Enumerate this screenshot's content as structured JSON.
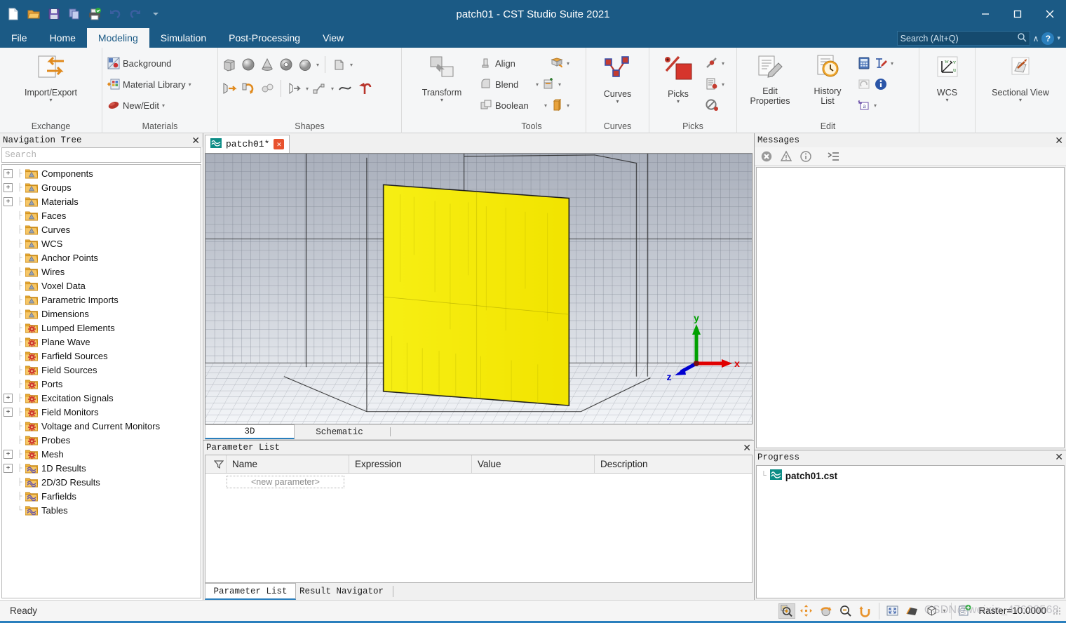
{
  "window": {
    "title": "patch01 - CST Studio Suite 2021",
    "minimize": "─",
    "maximize": "□",
    "close": "✕"
  },
  "quick_access": {
    "items": [
      {
        "name": "new-icon",
        "tip": "New"
      },
      {
        "name": "open-icon",
        "tip": "Open"
      },
      {
        "name": "save-icon",
        "tip": "Save"
      },
      {
        "name": "copy-icon",
        "tip": "Copy"
      },
      {
        "name": "print-icon",
        "tip": "Print"
      },
      {
        "name": "undo-icon",
        "tip": "Undo"
      },
      {
        "name": "redo-icon",
        "tip": "Redo"
      },
      {
        "name": "customize-icon",
        "tip": "Customize Quick Access Toolbar"
      }
    ]
  },
  "ribbon": {
    "tabs": [
      {
        "label": "File",
        "active": false
      },
      {
        "label": "Home",
        "active": false
      },
      {
        "label": "Modeling",
        "active": true
      },
      {
        "label": "Simulation",
        "active": false
      },
      {
        "label": "Post-Processing",
        "active": false
      },
      {
        "label": "View",
        "active": false
      }
    ],
    "search": {
      "placeholder": "Search (Alt+Q)",
      "value": ""
    },
    "help_label": "?",
    "collapse_label": "∧",
    "groups": [
      {
        "label": "Exchange",
        "big": {
          "label_line1": "Import/Export",
          "label_line2": "",
          "has_dropdown": true
        }
      },
      {
        "label": "Materials",
        "items": [
          {
            "label": "Background",
            "icon": "background-icon",
            "dropdown": false
          },
          {
            "label": "Material Library",
            "icon": "material-library-icon",
            "dropdown": true
          },
          {
            "label": "New/Edit",
            "icon": "new-edit-material-icon",
            "dropdown": true
          }
        ]
      },
      {
        "label": "Shapes",
        "row1": [
          "brick-icon",
          "sphere-icon",
          "cone-icon",
          "torus-icon",
          "ellipsoid-icon",
          "extrude-shape-icon"
        ],
        "row2": [
          "extrude-icon",
          "rotate-icon",
          "loft-icon",
          "extrude-curve-icon",
          "sweep-curve-icon",
          "trace-icon",
          "bend-icon"
        ]
      },
      {
        "label": "Tools",
        "items": [
          {
            "label": "Align",
            "icon": "align-icon",
            "dropdown": false
          },
          {
            "label": "Blend",
            "icon": "blend-icon",
            "dropdown": true
          },
          {
            "label": "Boolean",
            "icon": "boolean-icon",
            "dropdown": true
          }
        ],
        "side_icons": [
          "shape-tool-icon",
          "local-modification-icon",
          "material-tool-icon"
        ]
      },
      {
        "label": "Curves",
        "big": {
          "label_line1": "Curves",
          "label_line2": "",
          "has_dropdown": true
        }
      },
      {
        "label": "Picks",
        "big": {
          "label_line1": "Picks",
          "label_line2": "",
          "has_dropdown": true
        },
        "side_icons": [
          "pick-edge-icon",
          "pick-face-icon",
          "clear-picks-icon"
        ]
      },
      {
        "label": "Edit",
        "big1": {
          "label_line1": "Edit",
          "label_line2": "Properties",
          "has_dropdown": false
        },
        "big2": {
          "label_line1": "History",
          "label_line2": "List",
          "has_dropdown": false
        },
        "side_icons": [
          "calculator-icon",
          "update-icon",
          "parameters-icon",
          "rename-icon",
          "info-icon"
        ]
      },
      {
        "label": "",
        "big": {
          "label_line1": "WCS",
          "label_line2": "",
          "has_dropdown": true
        }
      },
      {
        "label": "",
        "big": {
          "label_line1": "Sectional View",
          "label_line2": "",
          "has_dropdown": true
        }
      }
    ]
  },
  "navigation_tree": {
    "title": "Navigation Tree",
    "close_label": "✕",
    "search_placeholder": "Search",
    "items": [
      {
        "label": "Components",
        "expandable": true,
        "icon": "folder-shape-icon"
      },
      {
        "label": "Groups",
        "expandable": true,
        "icon": "folder-shape-icon"
      },
      {
        "label": "Materials",
        "expandable": true,
        "icon": "folder-shape-icon"
      },
      {
        "label": "Faces",
        "expandable": false,
        "icon": "folder-shape-icon"
      },
      {
        "label": "Curves",
        "expandable": false,
        "icon": "folder-shape-icon"
      },
      {
        "label": "WCS",
        "expandable": false,
        "icon": "folder-shape-icon"
      },
      {
        "label": "Anchor Points",
        "expandable": false,
        "icon": "folder-shape-icon"
      },
      {
        "label": "Wires",
        "expandable": false,
        "icon": "folder-shape-icon"
      },
      {
        "label": "Voxel Data",
        "expandable": false,
        "icon": "folder-shape-icon"
      },
      {
        "label": "Parametric Imports",
        "expandable": false,
        "icon": "folder-shape-icon"
      },
      {
        "label": "Dimensions",
        "expandable": false,
        "icon": "folder-shape-icon"
      },
      {
        "label": "Lumped Elements",
        "expandable": false,
        "icon": "folder-gear-icon"
      },
      {
        "label": "Plane Wave",
        "expandable": false,
        "icon": "folder-gear-icon"
      },
      {
        "label": "Farfield Sources",
        "expandable": false,
        "icon": "folder-gear-icon"
      },
      {
        "label": "Field Sources",
        "expandable": false,
        "icon": "folder-gear-icon"
      },
      {
        "label": "Ports",
        "expandable": false,
        "icon": "folder-gear-icon"
      },
      {
        "label": "Excitation Signals",
        "expandable": true,
        "icon": "folder-gear-icon"
      },
      {
        "label": "Field Monitors",
        "expandable": true,
        "icon": "folder-gear-icon"
      },
      {
        "label": "Voltage and Current Monitors",
        "expandable": false,
        "icon": "folder-gear-icon"
      },
      {
        "label": "Probes",
        "expandable": false,
        "icon": "folder-gear-icon"
      },
      {
        "label": "Mesh",
        "expandable": true,
        "icon": "folder-gear-icon"
      },
      {
        "label": "1D Results",
        "expandable": true,
        "icon": "folder-results-icon"
      },
      {
        "label": "2D/3D Results",
        "expandable": false,
        "icon": "folder-results-icon"
      },
      {
        "label": "Farfields",
        "expandable": false,
        "icon": "folder-results-icon"
      },
      {
        "label": "Tables",
        "expandable": false,
        "icon": "folder-results-icon"
      }
    ]
  },
  "document_tabs": [
    {
      "label": "patch01*",
      "icon": "cst-doc-icon",
      "close_label": "✕",
      "active": true
    }
  ],
  "viewport": {
    "axes": {
      "x": "x",
      "y": "y",
      "z": "z",
      "x_color": "#e00000",
      "y_color": "#00a000",
      "z_color": "#0000d0"
    },
    "patch_color": "#f5ea00",
    "tabs": [
      {
        "label": "3D",
        "active": true
      },
      {
        "label": "Schematic",
        "active": false
      }
    ]
  },
  "parameter_list": {
    "title": "Parameter List",
    "close_label": "✕",
    "columns": [
      "Name",
      "Expression",
      "Value",
      "Description"
    ],
    "new_row_placeholder": "<new parameter>",
    "rows": [],
    "tabs": [
      {
        "label": "Parameter List",
        "active": true
      },
      {
        "label": "Result Navigator",
        "active": false
      }
    ]
  },
  "messages": {
    "title": "Messages",
    "close_label": "✕",
    "toolbar": [
      "errors-icon",
      "warnings-icon",
      "info-icon",
      "detail-icon"
    ],
    "entries": []
  },
  "progress": {
    "title": "Progress",
    "close_label": "✕",
    "items": [
      {
        "label": "patch01.cst",
        "icon": "cst-doc-icon"
      }
    ]
  },
  "statusbar": {
    "text": "Ready",
    "raster": "Raster=10.0000",
    "tools": [
      {
        "name": "zoom-tool-icon",
        "active": true
      },
      {
        "name": "pan-tool-icon",
        "active": false
      },
      {
        "name": "rotate-tool-icon",
        "active": false
      },
      {
        "name": "zoom-out-tool-icon",
        "active": false
      },
      {
        "name": "reset-view-icon",
        "active": false
      },
      {
        "name": "fit-view-icon",
        "active": false
      },
      {
        "name": "perspective-icon",
        "active": false
      },
      {
        "name": "view-cube-icon",
        "active": false
      },
      {
        "name": "screenshot-icon",
        "active": false
      }
    ],
    "watermark": "CSDN@weixin_47638568"
  }
}
